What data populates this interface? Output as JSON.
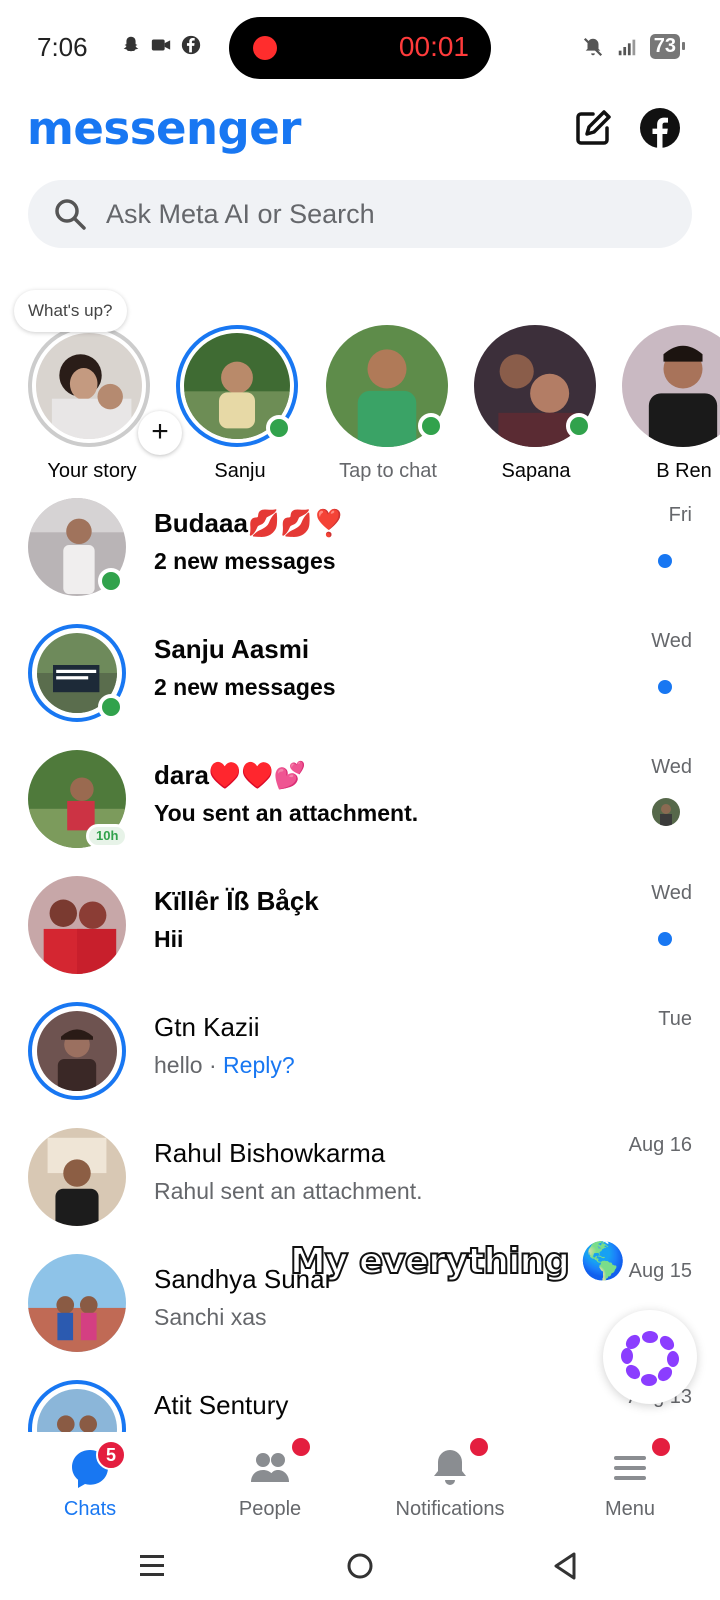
{
  "status_bar": {
    "time": "7:06",
    "recording_time": "00:01",
    "battery": "73",
    "network": "4G"
  },
  "header": {
    "brand": "messenger"
  },
  "search": {
    "placeholder": "Ask Meta AI or Search"
  },
  "stories": {
    "bubble_text": "What's up?",
    "items": [
      {
        "label": "Your story"
      },
      {
        "label": "Sanju"
      },
      {
        "label": "Tap to chat"
      },
      {
        "label": "Sapana"
      },
      {
        "label": "B Ren"
      }
    ]
  },
  "chats": [
    {
      "name": "Budaaa💋💋❣️",
      "message": "2 new messages",
      "time": "Fri"
    },
    {
      "name": "Sanju Aasmi",
      "message": "2 new messages",
      "time": "Wed"
    },
    {
      "name": "dara♥️♥️💕",
      "message": "You sent an attachment.",
      "time": "Wed",
      "active_ago": "10h"
    },
    {
      "name": "Kïllêr Ïß Båçk",
      "message": "Hii",
      "time": "Wed"
    },
    {
      "name": "Gtn Kazii",
      "message": "hello · ",
      "message_link": "Reply?",
      "time": "Tue"
    },
    {
      "name": "Rahul Bishowkarma",
      "message": "Rahul sent an attachment.",
      "time": "Aug 16"
    },
    {
      "name": "Sandhya Sunar",
      "message": "Sanchi xas",
      "time": "Aug 15"
    },
    {
      "name": "Atit Sentury",
      "message": "",
      "time": "Aug 13"
    }
  ],
  "overlay": {
    "caption": "My everything 🌎"
  },
  "bottom_nav": {
    "items": [
      {
        "label": "Chats",
        "badge": "5"
      },
      {
        "label": "People"
      },
      {
        "label": "Notifications"
      },
      {
        "label": "Menu"
      }
    ]
  },
  "colors": {
    "accent": "#1877f2",
    "online": "#31a24c",
    "badge": "#e41e3f",
    "muted": "#65676b"
  }
}
